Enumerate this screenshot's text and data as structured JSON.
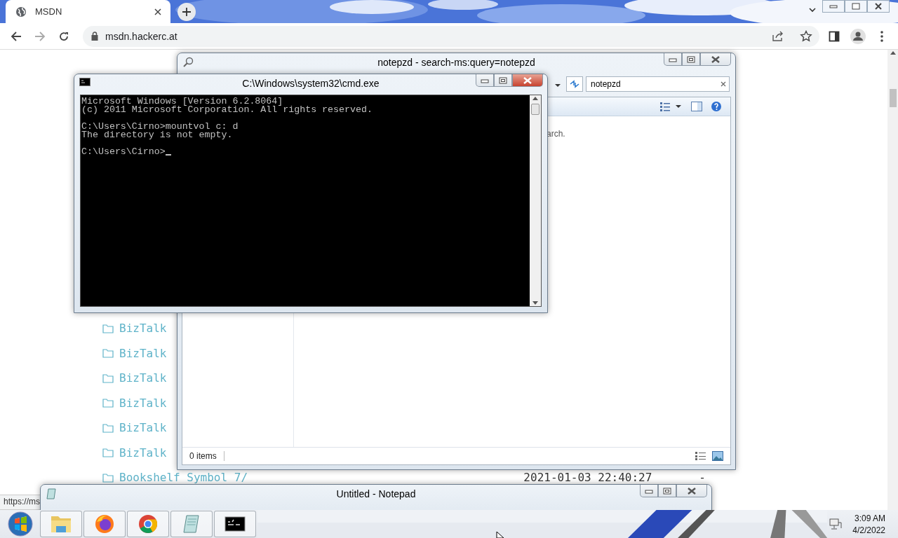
{
  "browser": {
    "tab": {
      "title": "MSDN"
    },
    "address": "msdn.hackerc.at",
    "items": [
      {
        "name": "BizTalk"
      },
      {
        "name": "BizTalk"
      },
      {
        "name": "BizTalk"
      },
      {
        "name": "BizTalk"
      },
      {
        "name": "BizTalk"
      },
      {
        "name": "BizTalk"
      },
      {
        "name": "Bookshelf Symbol 7/",
        "date": "2021-01-03 22:40:27",
        "size": "-"
      }
    ],
    "status_url": "https://ms"
  },
  "explorer": {
    "title": "notepzd - search-ms:query=notepzd",
    "search_value": "notepzd",
    "message": "arch.",
    "status": "0 items"
  },
  "cmd": {
    "title": "C:\\Windows\\system32\\cmd.exe",
    "blocks": [
      [
        "Microsoft Windows [Version 6.2.8064]",
        "(c) 2011 Microsoft Corporation. All rights reserved."
      ],
      [
        "C:\\Users\\Cirno>mountvol c: d",
        "The directory is not empty."
      ],
      [
        "C:\\Users\\Cirno>"
      ]
    ]
  },
  "notepad": {
    "title": "Untitled - Notepad"
  },
  "taskbar": {
    "apps": [
      {
        "kind": "explorer"
      },
      {
        "kind": "firefox"
      },
      {
        "kind": "chrome"
      },
      {
        "kind": "notepad"
      },
      {
        "kind": "cmd"
      }
    ],
    "time": "3:09 AM",
    "date": "4/2/2022"
  }
}
